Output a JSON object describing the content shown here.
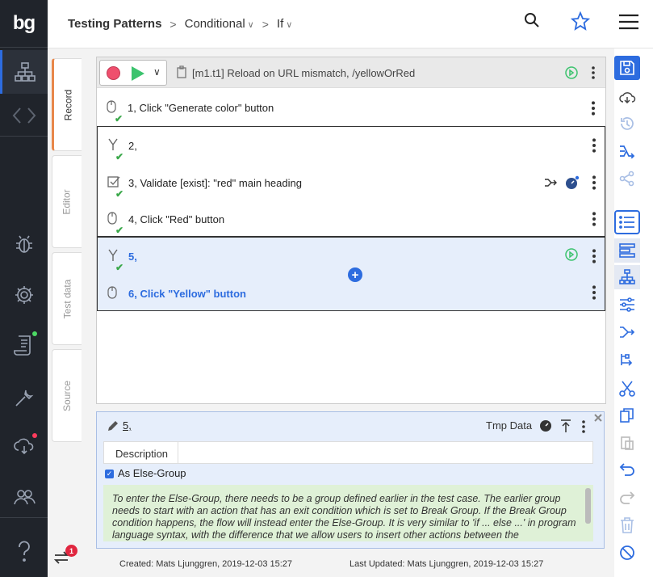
{
  "rail": {
    "logo": "bg",
    "badge_count": "1"
  },
  "header": {
    "crumb_project": "Testing Patterns",
    "crumb_sep": ">",
    "crumb_module": "Conditional",
    "crumb_case": "If"
  },
  "tabs": [
    "Record",
    "Editor",
    "Test data",
    "Source"
  ],
  "test_case": {
    "title": "[m1.t1] Reload on URL mismatch, /yellowOrRed",
    "steps": [
      {
        "label": "1, Click \"Generate color\" button",
        "icon": "mouse-icon"
      },
      {
        "label": "2,",
        "icon": "branch-icon"
      },
      {
        "label": "3, Validate [exist]: \"red\" main heading",
        "icon": "validate-icon"
      },
      {
        "label": "4, Click \"Red\" button",
        "icon": "mouse-icon"
      },
      {
        "label": "5,",
        "icon": "branch-icon"
      },
      {
        "label": "6, Click \"Yellow\" button",
        "icon": "mouse-icon"
      }
    ]
  },
  "detail": {
    "title": "5,",
    "tmp_data": "Tmp Data",
    "tab_description": "Description",
    "checkbox_label": "As Else-Group",
    "note": "To enter the Else-Group, there needs to be a group defined earlier in the test case. The earlier group needs to start with an action that has an exit condition which is set to Break Group. If the Break Group condition happens, the flow will instead enter the Else-Group. It is very similar to 'if ... else ...' in program language syntax, with the difference that we allow users to insert other actions between the"
  },
  "footer": {
    "created": "Created: Mats Ljunggren, 2019-12-03 15:27",
    "updated": "Last Updated: Mats Ljunggren, 2019-12-03 15:27"
  },
  "colors": {
    "accent": "#2d6cdf",
    "rail_bg": "#20242b",
    "success": "#3aa84a",
    "record": "#ef4f6d"
  }
}
